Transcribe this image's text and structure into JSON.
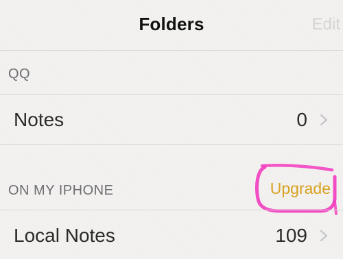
{
  "nav": {
    "title": "Folders",
    "edit_label": "Edit"
  },
  "sections": [
    {
      "header": "QQ",
      "rows": [
        {
          "label": "Notes",
          "count": "0"
        }
      ]
    },
    {
      "header": "ON MY IPHONE",
      "action": "Upgrade",
      "rows": [
        {
          "label": "Local Notes",
          "count": "109"
        }
      ]
    }
  ],
  "icons": {
    "chevron": "chevron-right-icon"
  },
  "colors": {
    "upgrade_accent": "#d8a11f",
    "highlight_annotation": "#f23bbf",
    "edit_disabled": "#d4d4d4"
  }
}
